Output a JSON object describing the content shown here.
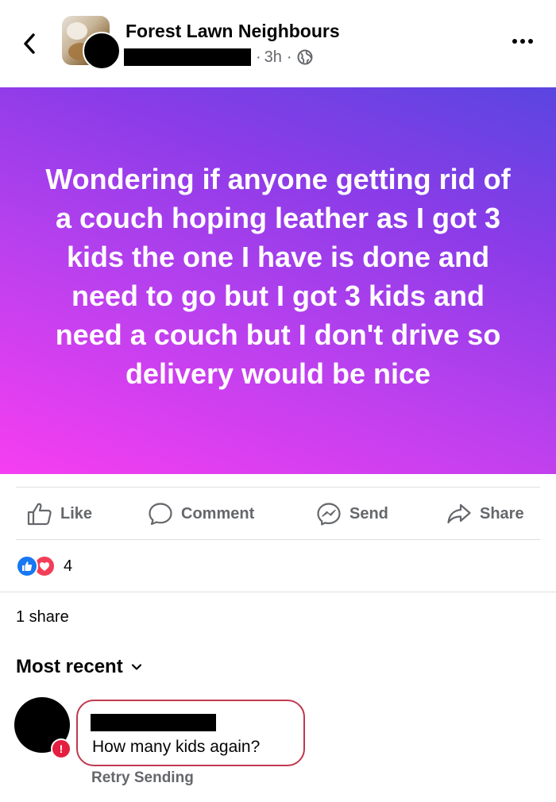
{
  "header": {
    "group_name": "Forest Lawn Neighbours",
    "separator": "·",
    "time": "3h",
    "separator2": "·",
    "audience_icon": "globe-icon",
    "back_icon": "chevron-left-icon",
    "more_icon": "more-icon"
  },
  "post": {
    "text": "Wondering if anyone getting rid of a couch hoping leather as I got 3 kids the one I have is done and need to go but I got 3 kids and need a couch but I don't drive so delivery would be nice",
    "background_gradient": [
      "#f63ef1",
      "#b940ee",
      "#8b3ce8",
      "#5a45e0"
    ]
  },
  "actions": {
    "like": "Like",
    "comment": "Comment",
    "send": "Send",
    "share": "Share"
  },
  "reactions": {
    "types": [
      "like",
      "love"
    ],
    "count": "4"
  },
  "shares": "1 share",
  "sort": {
    "label": "Most recent"
  },
  "comment": {
    "text": "How many kids again?",
    "status": "Retry Sending",
    "error_badge": "!"
  },
  "colors": {
    "like_blue": "#1877f2",
    "love_red": "#f33e58",
    "error_red": "#e41e3f",
    "secondary_text": "#65676b"
  }
}
